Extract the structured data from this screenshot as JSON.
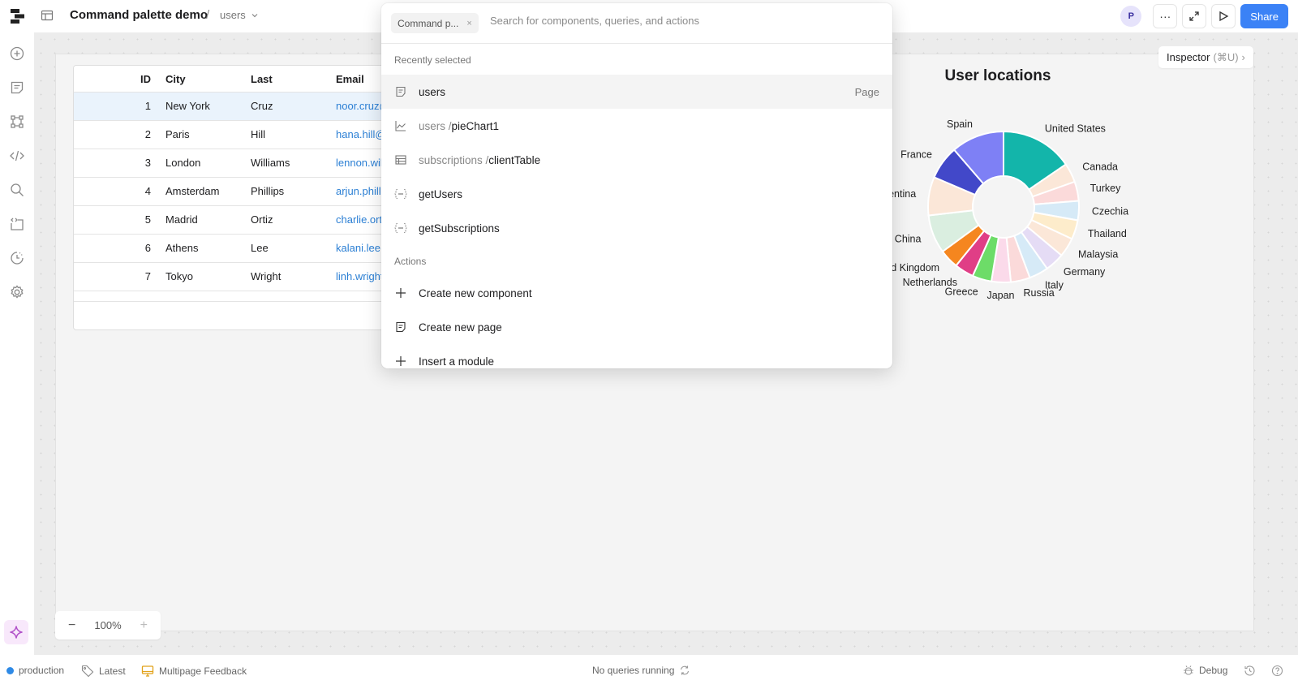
{
  "header": {
    "app_title": "Command palette demo",
    "separator": "/",
    "page": "users",
    "avatar_initial": "P",
    "more_label": "···",
    "share_label": "Share"
  },
  "sidebar": {
    "icons": [
      "add-component-icon",
      "pages-icon",
      "component-tree-icon",
      "code-icon",
      "search-icon",
      "code-block-icon",
      "history-icon",
      "settings-icon",
      "ai-assist-icon"
    ]
  },
  "table": {
    "columns": [
      "ID",
      "City",
      "Last",
      "Email"
    ],
    "rows": [
      {
        "id": "1",
        "city": "New York",
        "last": "Cruz",
        "email": "noor.cruz@"
      },
      {
        "id": "2",
        "city": "Paris",
        "last": "Hill",
        "email": "hana.hill@"
      },
      {
        "id": "3",
        "city": "London",
        "last": "Williams",
        "email": "lennon.wil"
      },
      {
        "id": "4",
        "city": "Amsterdam",
        "last": "Phillips",
        "email": "arjun.phill"
      },
      {
        "id": "5",
        "city": "Madrid",
        "last": "Ortiz",
        "email": "charlie.ort"
      },
      {
        "id": "6",
        "city": "Athens",
        "last": "Lee",
        "email": "kalani.lee@"
      },
      {
        "id": "7",
        "city": "Tokyo",
        "last": "Wright",
        "email": "linh.wright"
      }
    ],
    "selected_row": 0
  },
  "chart_data": {
    "type": "pie",
    "title": "User locations",
    "donut": true,
    "categories": [
      "United States",
      "Canada",
      "Turkey",
      "Czechia",
      "Thailand",
      "Malaysia",
      "Germany",
      "Italy",
      "Russia",
      "Japan",
      "Greece",
      "Netherlands",
      "United Kingdom",
      "China",
      "Argentina",
      "France",
      "Spain"
    ],
    "values": [
      15,
      4,
      4,
      4,
      4,
      4,
      4,
      4,
      4,
      4,
      4,
      4,
      4,
      8,
      8,
      7,
      11
    ],
    "colors": [
      "#13b5aa",
      "#fbe7d8",
      "#fbdada",
      "#d6eaf7",
      "#fdeccb",
      "#fbe7d8",
      "#e5dcf5",
      "#d6eaf7",
      "#fbdada",
      "#fbdaea",
      "#6ddc68",
      "#e03e86",
      "#f5861f",
      "#daeee0",
      "#fbe7d8",
      "#4248c9",
      "#7e80f5"
    ]
  },
  "inspector": {
    "label": "Inspector",
    "shortcut": "(⌘U)",
    "chevron": "›"
  },
  "zoom": {
    "minus": "−",
    "value": "100%",
    "plus": "+"
  },
  "palette": {
    "chip_label": "Command p...",
    "chip_close": "×",
    "search_placeholder": "Search for components, queries, and actions",
    "search_value": "",
    "recent_label": "Recently selected",
    "recent": [
      {
        "icon": "page-icon",
        "prefix": "",
        "name": "users",
        "right": "Page"
      },
      {
        "icon": "chart-icon",
        "prefix": "users / ",
        "name": "pieChart1",
        "right": ""
      },
      {
        "icon": "table-icon",
        "prefix": "subscriptions / ",
        "name": "clientTable",
        "right": ""
      },
      {
        "icon": "query-icon",
        "prefix": "",
        "name": "getUsers",
        "right": ""
      },
      {
        "icon": "query-icon",
        "prefix": "",
        "name": "getSubscriptions",
        "right": ""
      }
    ],
    "actions_label": "Actions",
    "actions": [
      {
        "icon": "plus-icon",
        "label": "Create new component"
      },
      {
        "icon": "page-icon",
        "label": "Create new page"
      },
      {
        "icon": "plus-icon",
        "label": "Insert a module"
      }
    ]
  },
  "statusbar": {
    "environment": "production",
    "environment_color": "#2e8ae6",
    "version": "Latest",
    "feedback": "Multipage Feedback",
    "queries": "No queries running",
    "debug": "Debug"
  }
}
